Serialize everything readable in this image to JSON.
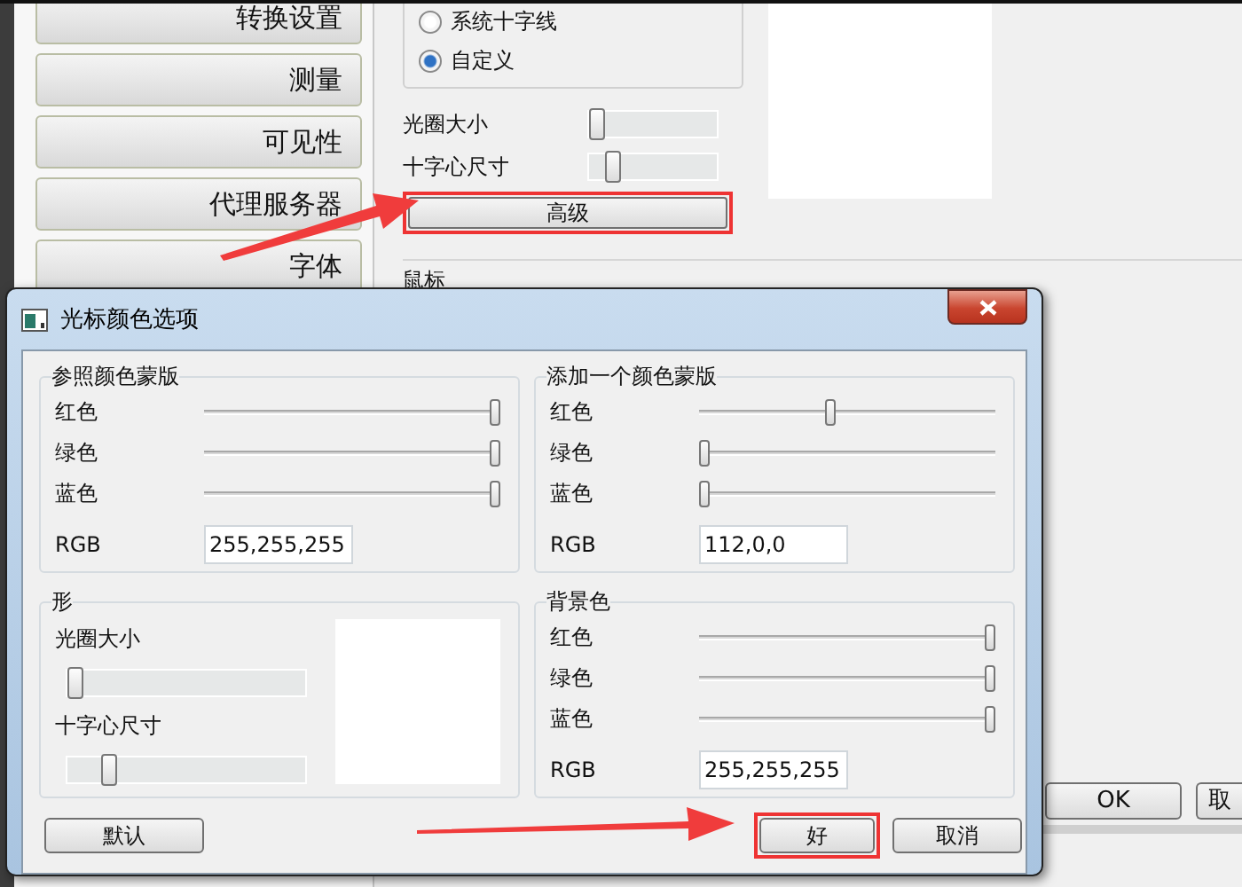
{
  "background_window": {
    "sidebar": {
      "items": [
        {
          "label": "转换设置"
        },
        {
          "label": "测量"
        },
        {
          "label": "可见性"
        },
        {
          "label": "代理服务器"
        },
        {
          "label": "字体"
        }
      ]
    },
    "crosshair_options": [
      {
        "label": "系统十字线",
        "selected": false
      },
      {
        "label": "自定义",
        "selected": true
      }
    ],
    "sliders": [
      {
        "label": "光圈大小",
        "level": 0
      },
      {
        "label": "十字心尺寸",
        "level": 0.15
      }
    ],
    "advanced_button": {
      "label": "高级",
      "highlighted": true
    },
    "mouse_group": {
      "title": "鼠标"
    },
    "buttons": [
      {
        "label": "OK"
      },
      {
        "label": "取"
      }
    ]
  },
  "dialog": {
    "title": "光标颜色选项",
    "groups": [
      {
        "kind": "color",
        "title": "参照颜色蒙版",
        "channels": [
          {
            "label": "红色",
            "level": 1
          },
          {
            "label": "绿色",
            "level": 1
          },
          {
            "label": "蓝色",
            "level": 1
          }
        ],
        "rgb_label": "RGB",
        "rgb": "255,255,255"
      },
      {
        "kind": "color",
        "title": "添加一个颜色蒙版",
        "channels": [
          {
            "label": "红色",
            "level": 0.44
          },
          {
            "label": "绿色",
            "level": 0
          },
          {
            "label": "蓝色",
            "level": 0
          }
        ],
        "rgb_label": "RGB",
        "rgb": "112,0,0"
      },
      {
        "kind": "shape",
        "title": "形",
        "sliders": [
          {
            "label": "光圈大小",
            "level": 0
          },
          {
            "label": "十字心尺寸",
            "level": 0.15
          }
        ]
      },
      {
        "kind": "color",
        "title": "背景色",
        "channels": [
          {
            "label": "红色",
            "level": 1
          },
          {
            "label": "绿色",
            "level": 1
          },
          {
            "label": "蓝色",
            "level": 1
          }
        ],
        "rgb_label": "RGB",
        "rgb": "255,255,255"
      }
    ],
    "buttons": [
      {
        "label": "默认",
        "highlighted": false
      },
      {
        "label": "好",
        "highlighted": true
      },
      {
        "label": "取消",
        "highlighted": false
      }
    ]
  }
}
